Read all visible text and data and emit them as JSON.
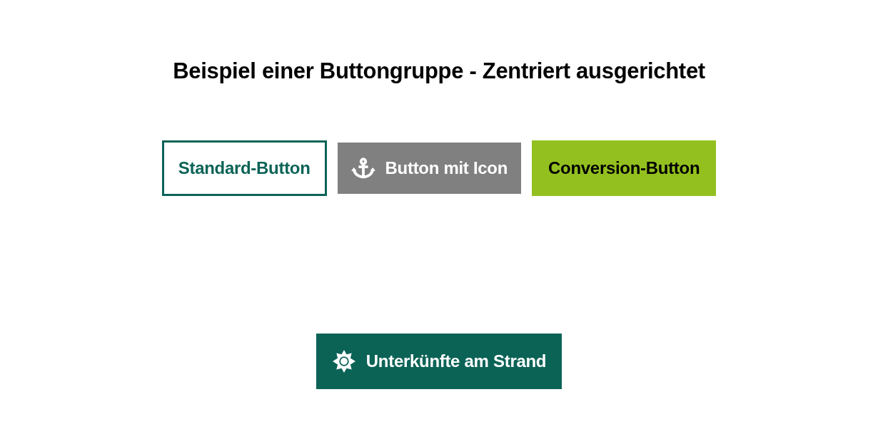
{
  "title": "Beispiel einer Buttongruppe - Zentriert ausgerichtet",
  "button_group": [
    {
      "label": "Standard-Button",
      "kind": "outline"
    },
    {
      "label": "Button mit Icon",
      "kind": "grey"
    },
    {
      "label": "Conversion-Button",
      "kind": "conversion"
    }
  ],
  "cta_button": {
    "label": "Unterkünfte am Strand",
    "kind": "primary"
  }
}
